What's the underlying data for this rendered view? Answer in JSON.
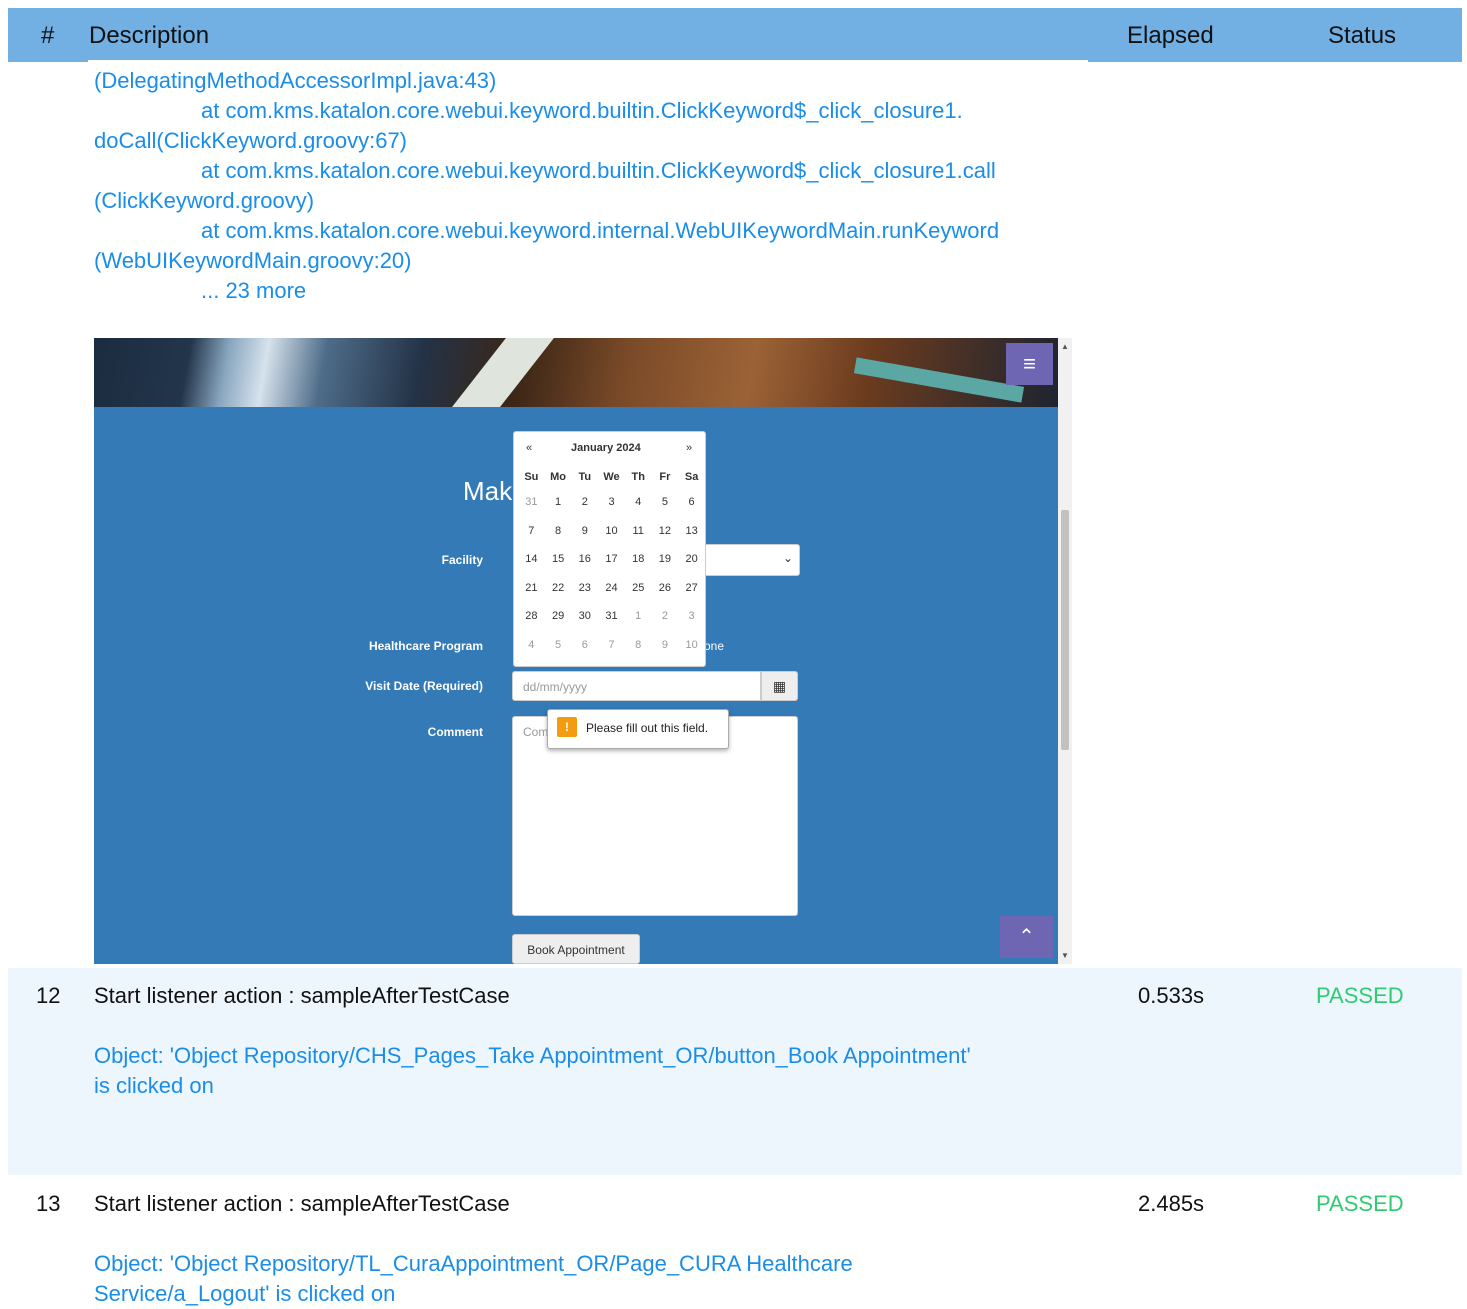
{
  "header": {
    "num": "#",
    "description": "Description",
    "elapsed": "Elapsed",
    "status": "Status"
  },
  "trace_lines": [
    "(DelegatingMethodAccessorImpl.java:43)",
    "at com.kms.katalon.core.webui.keyword.builtin.ClickKeyword$_click_closure1.",
    "doCall(ClickKeyword.groovy:67)",
    "at com.kms.katalon.core.webui.keyword.builtin.ClickKeyword$_click_closure1.call",
    "(ClickKeyword.groovy)",
    "at com.kms.katalon.core.webui.keyword.internal.WebUIKeywordMain.runKeyword",
    "(WebUIKeywordMain.groovy:20)",
    "... 23 more"
  ],
  "screenshot": {
    "title": "Mak",
    "facility_label": "Facility",
    "healthcare_label": "Healthcare Program",
    "radio_none": "one",
    "visit_date_label": "Visit Date (Required)",
    "visit_date_placeholder": "dd/mm/yyyy",
    "comment_label": "Comment",
    "comment_placeholder": "Com",
    "tooltip": "Please fill out this field.",
    "tooltip_icon": "!",
    "book_button": "Book Appointment",
    "calendar": {
      "prev": "«",
      "month": "January 2024",
      "next": "»",
      "weekdays": [
        "Su",
        "Mo",
        "Tu",
        "We",
        "Th",
        "Fr",
        "Sa"
      ],
      "weeks": [
        [
          "31",
          "1",
          "2",
          "3",
          "4",
          "5",
          "6"
        ],
        [
          "7",
          "8",
          "9",
          "10",
          "11",
          "12",
          "13"
        ],
        [
          "14",
          "15",
          "16",
          "17",
          "18",
          "19",
          "20"
        ],
        [
          "21",
          "22",
          "23",
          "24",
          "25",
          "26",
          "27"
        ],
        [
          "28",
          "29",
          "30",
          "31",
          "1",
          "2",
          "3"
        ],
        [
          "4",
          "5",
          "6",
          "7",
          "8",
          "9",
          "10"
        ]
      ]
    }
  },
  "rows": [
    {
      "num": "12",
      "description": "Start listener action : sampleAfterTestCase",
      "elapsed": "0.533s",
      "status": "PASSED",
      "object_line1": "Object: 'Object Repository/CHS_Pages_Take Appointment_OR/button_Book Appointment'",
      "object_line2": "is clicked on"
    },
    {
      "num": "13",
      "description": "Start listener action : sampleAfterTestCase",
      "elapsed": "2.485s",
      "status": "PASSED",
      "object_line1": "Object: 'Object Repository/TL_CuraAppointment_OR/Page_CURA Healthcare",
      "object_line2": "Service/a_Logout' is clicked on"
    }
  ],
  "colors": {
    "header_bg": "#72afe3",
    "link_blue": "#1a8de8",
    "passed_green": "#2ecc71",
    "row_highlight": "#eef6fd",
    "app_blue": "#337ab7"
  }
}
